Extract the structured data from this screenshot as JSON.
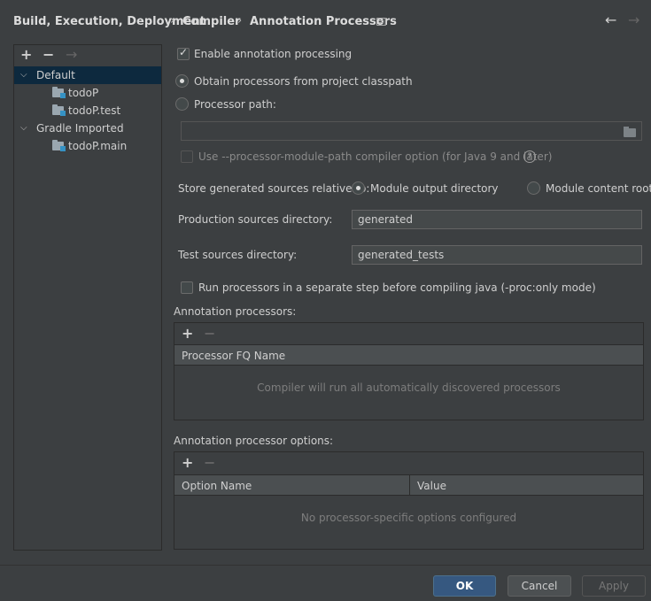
{
  "breadcrumb": {
    "items": [
      "Build, Execution, Deployment",
      "Compiler",
      "Annotation Processors"
    ],
    "separator": "›"
  },
  "nav": {
    "back": "←",
    "forward": "→"
  },
  "tree": {
    "toolbar": {
      "add": "+",
      "remove": "−",
      "move": "→"
    },
    "items": [
      {
        "label": "Default",
        "expanded": true,
        "selected": true,
        "icon": "chevron-down-icon"
      },
      {
        "label": "todoP",
        "icon": "module-folder-icon"
      },
      {
        "label": "todoP.test",
        "icon": "module-folder-icon"
      },
      {
        "label": "Gradle Imported",
        "expanded": true,
        "icon": "chevron-down-icon"
      },
      {
        "label": "todoP.main",
        "icon": "module-folder-icon"
      }
    ]
  },
  "form": {
    "enable_processing": {
      "label": "Enable annotation processing",
      "checked": true
    },
    "obtain_classpath": {
      "label": "Obtain processors from project classpath",
      "selected": true
    },
    "processor_path": {
      "label": "Processor path:",
      "selected": false,
      "value": ""
    },
    "module_path_option": {
      "label": "Use --processor-module-path compiler option (for Java 9 and later)",
      "checked": false,
      "help": "?"
    },
    "store_relative": {
      "label": "Store generated sources relative to:",
      "option_output": "Module output directory",
      "option_content": "Module content root",
      "selected": "Module output directory"
    },
    "production_dir": {
      "label": "Production sources directory:",
      "value": "generated"
    },
    "test_dir": {
      "label": "Test sources directory:",
      "value": "generated_tests"
    },
    "separate_step": {
      "label": "Run processors in a separate step before compiling java (-proc:only mode)",
      "checked": false
    }
  },
  "processors": {
    "title": "Annotation processors:",
    "add": "+",
    "remove": "−",
    "column": "Processor FQ Name",
    "empty": "Compiler will run all automatically discovered processors"
  },
  "options": {
    "title": "Annotation processor options:",
    "add": "+",
    "remove": "−",
    "columns": [
      "Option Name",
      "Value"
    ],
    "empty": "No processor-specific options configured"
  },
  "buttons": {
    "ok": "OK",
    "cancel": "Cancel",
    "apply": "Apply"
  },
  "colors": {
    "background": "#3c3f41",
    "selection": "#0d293e",
    "primary_button": "#365880"
  }
}
